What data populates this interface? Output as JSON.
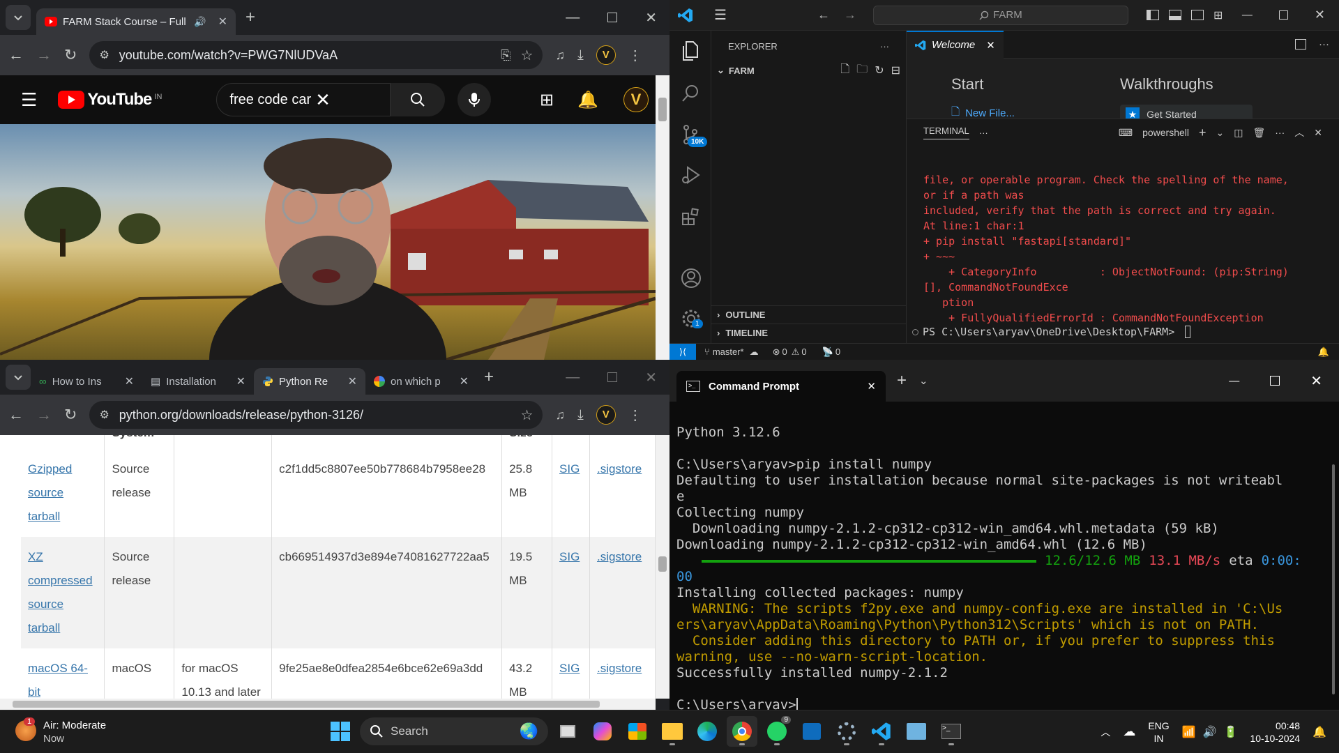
{
  "yt_window": {
    "tab_title": "FARM Stack Course – Full St",
    "url": "youtube.com/watch?v=PWG7NlUDVaA",
    "logo_text": "YouTube",
    "region": "IN",
    "search_value": "free code car",
    "avatar_letter": "V"
  },
  "py_window": {
    "tabs": [
      {
        "label": "How to Ins",
        "icon": "link-icon"
      },
      {
        "label": "Installation",
        "icon": "doc-icon"
      },
      {
        "label": "Python Re",
        "icon": "python-icon"
      },
      {
        "label": "on which p",
        "icon": "google-icon"
      }
    ],
    "url": "python.org/downloads/release/python-3126/",
    "header_partial": {
      "os": "System",
      "size": "Size"
    },
    "rows": [
      {
        "lines": [
          "Gzipped",
          "source",
          "tarball"
        ],
        "os": [
          "Source",
          "release"
        ],
        "desc": [],
        "md5": "c2f1dd5c8807ee50b778684b7958ee28",
        "size": "25.8 MB",
        "sig": "SIG",
        "sigstore": ".sigstore"
      },
      {
        "lines": [
          "XZ",
          "compressed",
          "source",
          "tarball"
        ],
        "os": [
          "Source",
          "release"
        ],
        "desc": [],
        "md5": "cb669514937d3e894e74081627722aa5",
        "size": "19.5 MB",
        "sig": "SIG",
        "sigstore": ".sigstore"
      },
      {
        "lines": [
          "macOS 64-",
          "bit"
        ],
        "os": [
          "macOS"
        ],
        "desc": [
          "for macOS",
          "10.13 and later"
        ],
        "md5": "9fe25ae8e0dfea2854e6bce62e69a3dd",
        "size": "43.2 MB",
        "sig": "SIG",
        "sigstore": ".sigstore"
      }
    ]
  },
  "vscode": {
    "search": "FARM",
    "explorer_label": "EXPLORER",
    "folder": "FARM",
    "outline": "OUTLINE",
    "timeline": "TIMELINE",
    "tab_welcome": "Welcome",
    "start": "Start",
    "walkthroughs": "Walkthroughs",
    "new_file": "New File...",
    "walk_partial": "Get Started",
    "scm_badge": "10K",
    "settings_badge": "1",
    "terminal_label": "TERMINAL",
    "shell": "powershell",
    "terminal_lines": [
      "file, or operable program. Check the spelling of the name,",
      "or if a path was",
      "included, verify that the path is correct and try again.",
      "At line:1 char:1",
      "+ pip install \"fastapi[standard]\"",
      "+ ~~~",
      "    + CategoryInfo          : ObjectNotFound: (pip:String)",
      "[], CommandNotFoundExce",
      "   ption",
      "    + FullyQualifiedErrorId : CommandNotFoundException"
    ],
    "prompt": "PS C:\\Users\\aryav\\OneDrive\\Desktop\\FARM> ",
    "status": {
      "branch": "master*",
      "errors": "0",
      "warnings": "0",
      "ports": "0"
    }
  },
  "cmd": {
    "title": "Command Prompt",
    "line1": "Python 3.12.6",
    "line2": "C:\\Users\\aryav>pip install numpy",
    "line3": "Defaulting to user installation because normal site-packages is not writeabl",
    "line4": "e",
    "line5": "Collecting numpy",
    "line6": "  Downloading numpy-2.1.2-cp312-cp312-win_amd64.whl.metadata (59 kB)",
    "line7": "Downloading numpy-2.1.2-cp312-cp312-win_amd64.whl (12.6 MB)",
    "progress_size": "12.6/12.6 MB",
    "progress_speed": "13.1 MB/s",
    "progress_eta_label": "eta",
    "progress_eta": "0:00:",
    "progress_eta2": "00",
    "progress_fraction": 1.0,
    "line8": "Installing collected packages: numpy",
    "warn1": "  WARNING: The scripts f2py.exe and numpy-config.exe are installed in 'C:\\Us",
    "warn2": "ers\\aryav\\AppData\\Roaming\\Python\\Python312\\Scripts' which is not on PATH.",
    "warn3": "  Consider adding this directory to PATH or, if you prefer to suppress this",
    "warn4": "warning, use --no-warn-script-location.",
    "line9": "Successfully installed numpy-2.1.2",
    "prompt": "C:\\Users\\aryav>"
  },
  "taskbar": {
    "weather_title": "Air: Moderate",
    "weather_sub": "Now",
    "weather_badge": "1",
    "search": "Search",
    "whatsapp_badge": "9",
    "lang1": "ENG",
    "lang2": "IN",
    "time": "00:48",
    "date": "10-10-2024"
  }
}
